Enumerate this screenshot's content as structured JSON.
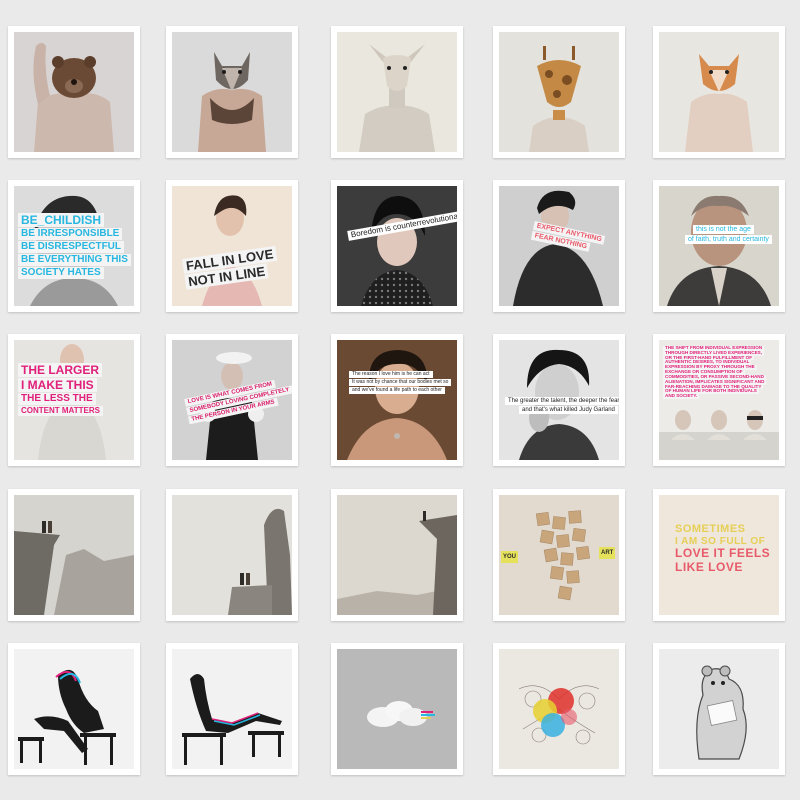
{
  "captions": {
    "childish": [
      "BE_CHILDISH",
      "BE IRRESPONSIBLE",
      "BE DISRESPECTFUL",
      "BE EVERYTHING THIS",
      "SOCIETY HATES"
    ],
    "fall_in_love": [
      "FALL IN LOVE",
      "NOT IN LINE"
    ],
    "boredom": "Boredom is counterrevolutionary",
    "expect": [
      "EXPECT ANYTHING",
      "FEAR NOTHING"
    ],
    "not_the_age": [
      "this is not the age",
      "of faith, truth and certainty"
    ],
    "larger": [
      "THE LARGER",
      "I MAKE THIS",
      "THE LESS THE",
      "CONTENT MATTERS"
    ],
    "love_is": [
      "LOVE IS WHAT COMES FROM",
      "SOMEBODY LOVING COMPLETELY",
      "THE PERSON IN YOUR ARMS"
    ],
    "elizabeth": [
      "The reason I love him is he can act",
      "It was not by chance that our bodies met so",
      "and we've found a life path to each other"
    ],
    "greater": [
      "The greater the talent, the deeper the fear",
      "and that's what killed Judy Garland"
    ],
    "shift": [
      "THE SHIFT FROM INDIVIDUAL EXPRESSION",
      "THROUGH DIRECTLY LIVED EXPERIENCES,",
      "OR THE FIRST-HAND FULFILLMENT OF",
      "AUTHENTIC DESIRES, TO INDIVIDUAL",
      "EXPRESSION BY PROXY THROUGH THE",
      "EXCHANGE OR CONSUMPTION OF",
      "COMMODITIES, OR PASSIVE SECOND-HAND",
      "ALIENATION, IMPLICATES SIGNIFICANT AND",
      "FAR-REACHING DAMAGE TO THE QUALITY",
      "OF HUMAN LIFE FOR BOTH INDIVIDUALS",
      "AND SOCIETY."
    ],
    "you": "YOU",
    "art": "ART",
    "sometimes": [
      "SOMETIMES",
      "I AM SO FULL OF",
      "LOVE IT FEELS",
      "LIKE LOVE"
    ]
  },
  "colors": {
    "cyan": "#27b7e0",
    "magenta": "#e0207a",
    "pink": "#d81e6a",
    "yellow": "#e6cf55",
    "coral": "#e85a6a",
    "dark": "#2a2a2a"
  }
}
